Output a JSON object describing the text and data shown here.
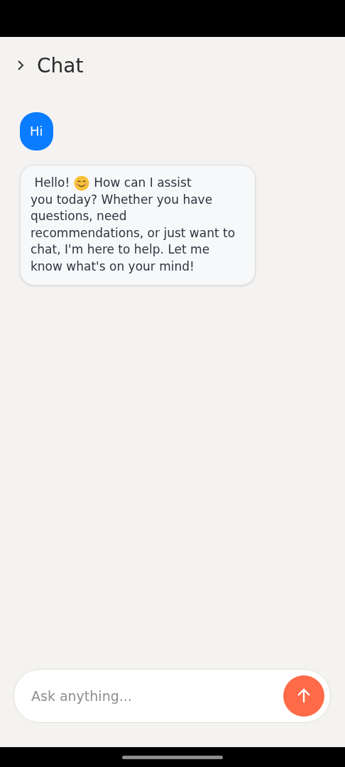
{
  "header": {
    "title": "Chat"
  },
  "messages": [
    {
      "kind": "user",
      "text": "Hi"
    },
    {
      "kind": "assistant",
      "greeting": "Hello!",
      "lead": "How can I assist",
      "text": "you today? Whether you have questions, need recommendations, or just want to chat, I'm here to help. Let me know what's on your mind!"
    }
  ],
  "composer": {
    "placeholder": "Ask anything..."
  }
}
